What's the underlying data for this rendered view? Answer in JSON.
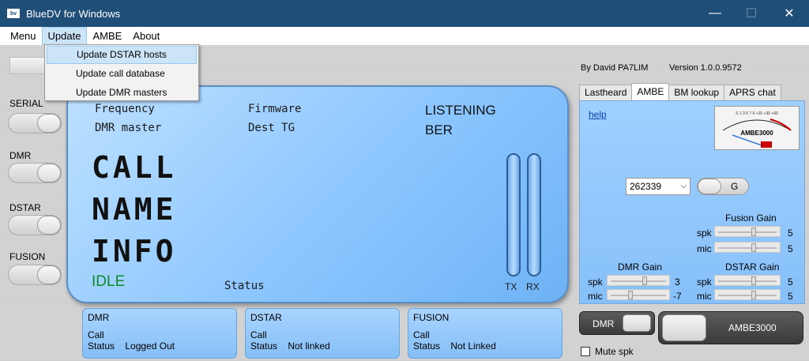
{
  "window": {
    "title": "BlueDV for Windows",
    "icon_text": "bv",
    "minimize_icon": "—",
    "maximize_icon": "☐",
    "close_icon": "✕"
  },
  "menu": {
    "items": [
      "Menu",
      "Update",
      "AMBE",
      "About"
    ],
    "active": "Update"
  },
  "dropdown": {
    "items": [
      "Update DSTAR hosts",
      "Update call database",
      "Update DMR masters"
    ],
    "highlighted": "Update DSTAR hosts"
  },
  "left": {
    "serial": "SERIAL",
    "dmr": "DMR",
    "dstar": "DSTAR",
    "fusion": "FUSION"
  },
  "lcd": {
    "frequency": "Frequency",
    "dmr_master": "DMR master",
    "firmware": "Firmware",
    "dest_tg": "Dest TG",
    "listening": "LISTENING",
    "ber": "BER",
    "call": "CALL",
    "name": "NAME",
    "info": "INFO",
    "idle": "IDLE",
    "status": "Status",
    "tx": "TX",
    "rx": "RX"
  },
  "boxes": [
    {
      "title": "DMR",
      "call": "Call",
      "status_label": "Status",
      "status_value": "Logged Out"
    },
    {
      "title": "DSTAR",
      "call": "Call",
      "status_label": "Status",
      "status_value": "Not linked"
    },
    {
      "title": "FUSION",
      "call": "Call",
      "status_label": "Status",
      "status_value": "Not Linked"
    }
  ],
  "credits": {
    "author": "By David PA7LIM",
    "version": "Version 1.0.0.9572"
  },
  "tabs": [
    "Lastheard",
    "AMBE",
    "BM lookup",
    "APRS chat"
  ],
  "active_tab": "AMBE",
  "ambe": {
    "help": "help",
    "meter_label": "AMBE3000",
    "meter_scale": "S 1 3 5 7 9 +10 +30 +60",
    "select_value": "262339",
    "g_label": "G",
    "fusion_gain": {
      "title": "Fusion Gain",
      "spk_label": "spk",
      "spk": 5,
      "mic_label": "mic",
      "mic": 5
    },
    "dmr_gain": {
      "title": "DMR Gain",
      "spk_label": "spk",
      "spk": 3,
      "mic_label": "mic",
      "mic": -7
    },
    "dstar_gain": {
      "title": "DSTAR Gain",
      "spk_label": "spk",
      "spk": 5,
      "mic_label": "mic",
      "mic": 5
    }
  },
  "bottom": {
    "dmr_toggle": "DMR",
    "ambe_toggle": "AMBE3000",
    "mute": "Mute spk",
    "mute_checked": false
  }
}
